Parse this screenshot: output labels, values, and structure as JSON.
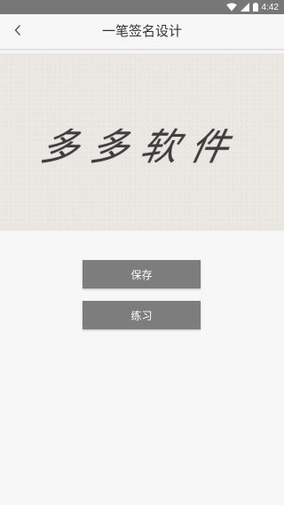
{
  "status_bar": {
    "time": "4:42",
    "icons": [
      "wifi-icon",
      "signal-icon",
      "battery-icon"
    ]
  },
  "header": {
    "back_icon": "chevron-left-icon",
    "title": "一笔签名设计"
  },
  "preview": {
    "signature_text": "多多软件"
  },
  "actions": {
    "save_label": "保存",
    "practice_label": "练习"
  },
  "colors": {
    "status_bar": "#777777",
    "button": "#7d7d7d",
    "preview_bg": "#ebe7e2",
    "page_bg": "#f7f7f7"
  }
}
